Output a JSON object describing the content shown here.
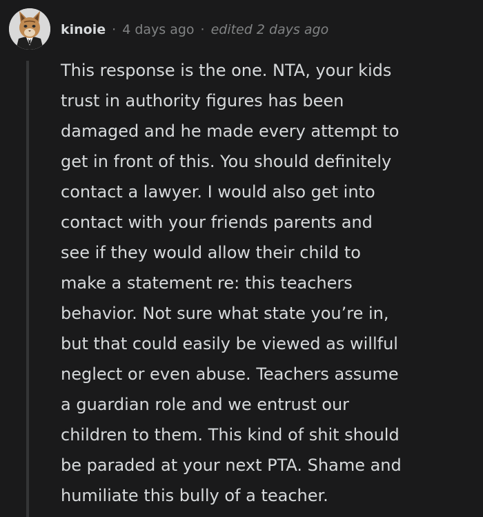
{
  "comment": {
    "author": "kinoie",
    "separator": "·",
    "timestamp": "4 days ago",
    "edited": "edited 2 days ago",
    "avatar_icon": "cat-in-suit-avatar-icon",
    "body_lines": [
      "This response is the one. NTA, your kids",
      "trust in authority figures has been",
      "damaged and he made every attempt to",
      "get in front of this. You should definitely",
      "contact a lawyer. I would also get into",
      "contact with your friends parents and",
      "see if they would allow their child to",
      "make a statement re: this teachers",
      "behavior. Not sure what state you’re in,",
      "but that could easily be viewed as willful",
      "neglect or even abuse. Teachers assume",
      "a guardian role and we entrust our",
      "children to them. This kind of shit should",
      "be paraded at your next PTA. Shame and",
      "humiliate this bully of a teacher."
    ]
  },
  "colors": {
    "background": "#1a1a1b",
    "text": "#d7dadc",
    "meta": "#818384",
    "thread_line": "#343536"
  }
}
